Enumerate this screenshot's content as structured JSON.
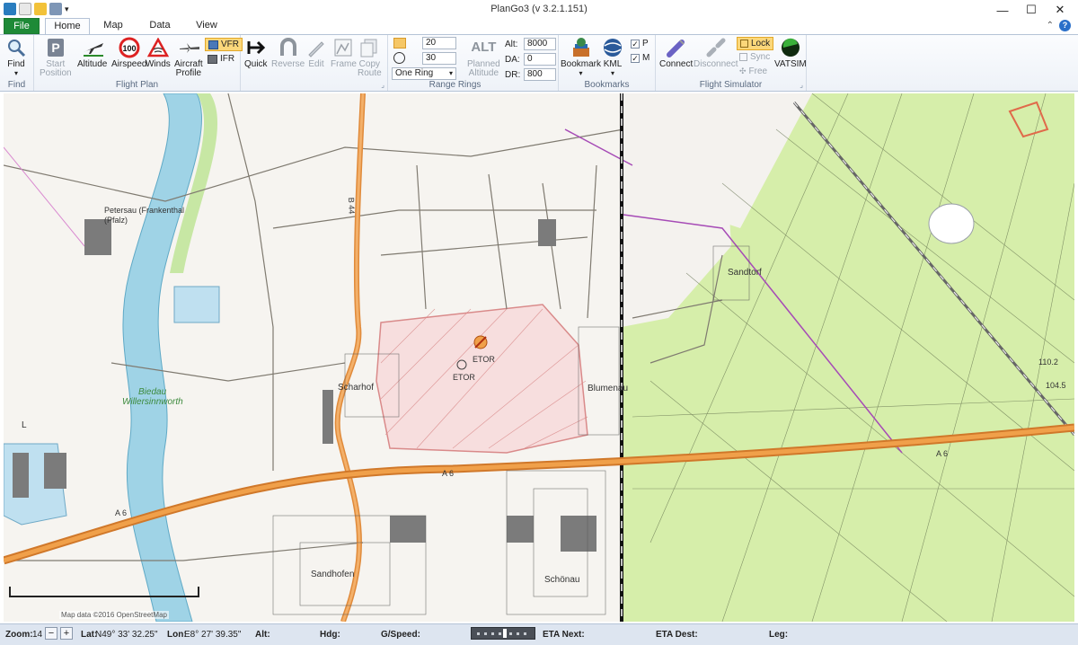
{
  "window": {
    "title": "PlanGo3 (v 3.2.1.151)",
    "controls": [
      "minimize-icon",
      "maximize-icon",
      "close-icon"
    ]
  },
  "tabs": {
    "file": "File",
    "home": "Home",
    "map": "Map",
    "data": "Data",
    "view": "View"
  },
  "ribbon": {
    "find": {
      "label": "Find",
      "group": "Find"
    },
    "flight_plan": {
      "group": "Flight Plan",
      "start_position": [
        "Start",
        "Position"
      ],
      "altitude": "Altitude",
      "airspeed": "Airspeed",
      "airspeed_value": "100",
      "winds": "Winds",
      "aircraft_profile": [
        "Aircraft",
        "Profile"
      ],
      "vfr": "VFR",
      "ifr": "IFR"
    },
    "route": {
      "quick": "Quick",
      "reverse": "Reverse",
      "edit": "Edit",
      "frame": "Frame",
      "copy_route": [
        "Copy",
        "Route"
      ]
    },
    "range_rings": {
      "group": "Range Rings",
      "ring_value_1": "20",
      "ring_value_2": "30",
      "mode": "One Ring",
      "planned_altitude": [
        "Planned",
        "Altitude"
      ],
      "alt_icon": "ALT",
      "alt_label": "Alt:",
      "alt_value": "8000",
      "da_label": "DA:",
      "da_value": "0",
      "dr_label": "DR:",
      "dr_value": "800"
    },
    "bookmarks": {
      "group": "Bookmarks",
      "bookmark": "Bookmark",
      "kml": "KML",
      "p": "P",
      "m": "M"
    },
    "flight_simulator": {
      "group": "Flight Simulator",
      "connect": "Connect",
      "disconnect": "Disconnect",
      "lock": "Lock",
      "sync": "Sync",
      "free": "Free",
      "vatsim": "VATSIM"
    }
  },
  "map": {
    "labels": {
      "petersau": "Petersau (Frankenthal",
      "pfalz": "(Pfalz)",
      "scharhof": "Scharhof",
      "etor": "ETOR",
      "etor2": "ETOR",
      "blumenau": "Blumenau",
      "sandtorf": "Sandtorf",
      "sandhofen": "Sandhofen",
      "schonau": "Schönau",
      "biedau": "Biedau",
      "willersinnworth": "Willersinnworth",
      "a6_left": "A 6",
      "a6_mid": "A 6",
      "a6_right": "A 6",
      "b44": "B 44",
      "elev1": "110.2",
      "elev2": "104.5",
      "l_letter": "L"
    },
    "attribution": "Map data ©2016 OpenStreetMap"
  },
  "status": {
    "zoom_label": "Zoom:",
    "zoom_value": "14",
    "lat_label": "Lat:",
    "lat_value": "N49° 33' 32.25\"",
    "lon_label": "Lon:",
    "lon_value": "E8° 27' 39.35\"",
    "alt_label": "Alt:",
    "hdg_label": "Hdg:",
    "gspeed_label": "G/Speed:",
    "eta_next_label": "ETA Next:",
    "eta_dest_label": "ETA Dest:",
    "leg_label": "Leg:"
  },
  "colors": {
    "file_tab": "#1e8a37",
    "river": "#9fd3e6",
    "forest": "#d6eeaa",
    "highway": "#f0a04a",
    "restricted": "#d98a8a"
  }
}
